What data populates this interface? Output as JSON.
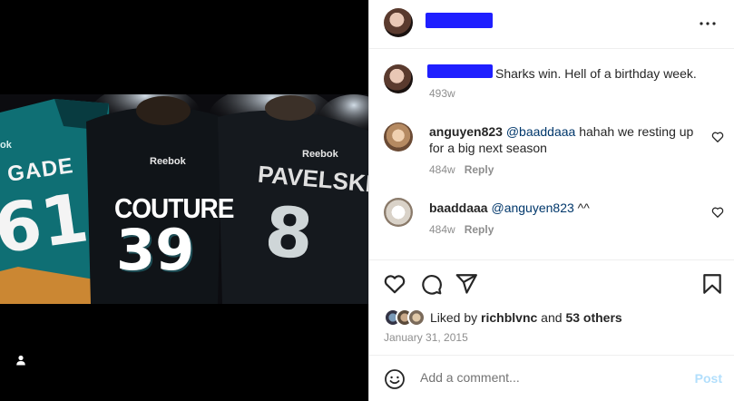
{
  "post": {
    "author_avatar": "avatar",
    "caption": "Sharks win. Hell of a birthday week.",
    "caption_time": "493w",
    "more_icon": "more-horizontal-icon"
  },
  "photo": {
    "jerseys": [
      {
        "name": "GADE",
        "number": "61",
        "brand": ""
      },
      {
        "name": "COUTURE",
        "number": "39",
        "brand": "Reebok"
      },
      {
        "name": "PAVELSKI",
        "number": "8",
        "brand": "Reebok"
      }
    ],
    "left_brand": "ok"
  },
  "comments": [
    {
      "user": "anguyen823",
      "mention": "@baaddaaa",
      "text": " hahah we resting up for a big next season",
      "time": "484w",
      "reply_label": "Reply"
    },
    {
      "user": "baaddaaa",
      "mention": "@anguyen823",
      "text": " ^^",
      "time": "484w",
      "reply_label": "Reply"
    }
  ],
  "likes": {
    "prefix": "Liked by ",
    "user": "richblvnc",
    "middle": " and ",
    "others": "53 others"
  },
  "date": "January 31, 2015",
  "add_comment": {
    "placeholder": "Add a comment...",
    "post_label": "Post"
  },
  "colors": {
    "redaction": "#1f1fff",
    "link": "#00376b",
    "muted": "#8e8e8e",
    "post_disabled": "#b2dffc"
  }
}
